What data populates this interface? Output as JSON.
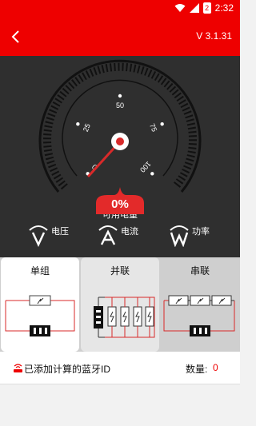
{
  "status_bar": {
    "time": "2:32",
    "battery_level": "2",
    "icons": [
      "wifi-icon",
      "signal-icon",
      "battery-icon"
    ]
  },
  "header": {
    "version": "V 3.1.31",
    "back_icon": "chevron-left-icon"
  },
  "gauge": {
    "ticks": [
      "0",
      "25",
      "50",
      "75",
      "100"
    ],
    "label": "可用电量",
    "percent_text": "0%",
    "needle_value": 0
  },
  "metrics": [
    {
      "icon": "voltage-icon",
      "label": "电压"
    },
    {
      "icon": "current-icon",
      "label": "电流"
    },
    {
      "icon": "power-icon",
      "label": "功率"
    }
  ],
  "tabs": [
    {
      "label": "单组",
      "selected": true
    },
    {
      "label": "并联",
      "selected": false
    },
    {
      "label": "串联",
      "selected": false
    }
  ],
  "list": {
    "title": "已添加计算的蓝牙ID",
    "count_label": "数量:",
    "count_value": "0"
  },
  "colors": {
    "brand_red": "#ee0000",
    "panel_dark": "#2f2f2f"
  }
}
